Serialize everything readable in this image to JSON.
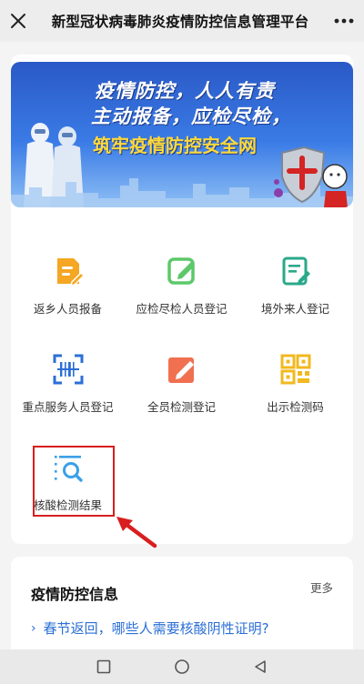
{
  "header": {
    "title": "新型冠状病毒肺炎疫情防控信息管理平台",
    "close_icon": "close-icon",
    "more_icon": "more-dots-icon"
  },
  "banner": {
    "line1": "疫情防控，人人有责",
    "line2": "主动报备，应检尽检，",
    "line3": "筑牢疫情防控安全网",
    "active_dot": 2,
    "dot_count": 3
  },
  "grid": {
    "items": [
      {
        "label": "返乡人员报备",
        "icon": "document-edit-icon",
        "color": "#f5a623"
      },
      {
        "label": "应检尽检人员登记",
        "icon": "edit-square-icon",
        "color": "#5cc86a"
      },
      {
        "label": "境外来人登记",
        "icon": "form-edit-icon",
        "color": "#2aa98a"
      },
      {
        "label": "重点服务人员登记",
        "icon": "scan-icon",
        "color": "#2b6fd6"
      },
      {
        "label": "全员检测登记",
        "icon": "pen-box-icon",
        "color": "#f07050"
      },
      {
        "label": "出示检测码",
        "icon": "qr-code-icon",
        "color": "#f2b81f"
      },
      {
        "label": "核酸检测结果",
        "icon": "search-list-icon",
        "color": "#3aa0e8"
      }
    ],
    "highlight_color": "#d81e1e"
  },
  "info": {
    "title": "疫情防控信息",
    "more": "更多",
    "items": [
      "春节返回，哪些人需要核酸阴性证明?"
    ]
  },
  "navbar": {
    "buttons": [
      "recent-apps-icon",
      "home-icon",
      "back-icon"
    ]
  }
}
